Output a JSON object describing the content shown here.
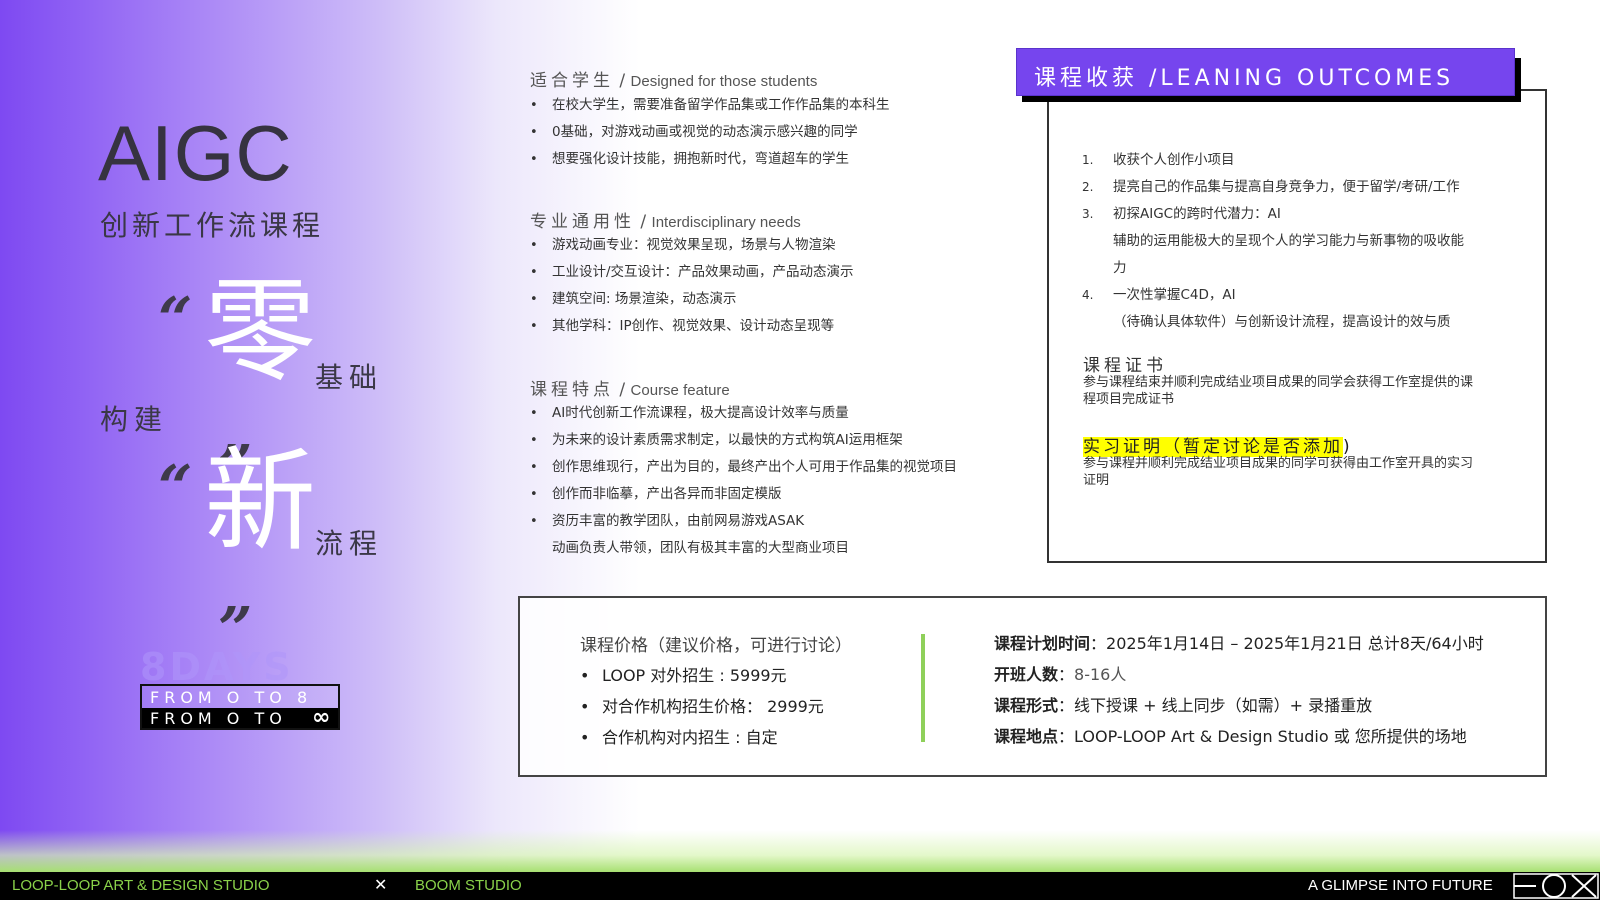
{
  "hero": {
    "title": "AIGC",
    "subtitle": "创新工作流课程",
    "quote_open": "“",
    "quote_close": "”",
    "char_zero": "零",
    "word_basic": "基础",
    "word_build": "构建",
    "char_new": "新",
    "word_flow": "流程",
    "days": "8DAYS",
    "from_line1": "FROM O TO 8",
    "from_line2": "FROM O TO",
    "infinity": "∞"
  },
  "students": {
    "title_zh": "适合学生",
    "sep": " / ",
    "title_en": "Designed for those students",
    "items": [
      "在校大学生，需要准备留学作品集或工作作品集的本科生",
      "0基础，对游戏动画或视觉的动态演示感兴趣的同学",
      "想要强化设计技能，拥抱新时代，弯道超车的学生"
    ]
  },
  "interdisciplinary": {
    "title_zh": "专业通用性",
    "sep": " / ",
    "title_en": "Interdisciplinary needs",
    "items": [
      "游戏动画专业：视觉效果呈现，场景与人物渲染",
      "工业设计/交互设计：产品效果动画，产品动态演示",
      "建筑空间: 场景渲染，动态演示",
      "其他学科：IP创作、视觉效果、设计动态呈现等"
    ]
  },
  "features": {
    "title_zh": "课程特点",
    "sep": " / ",
    "title_en": "Course feature",
    "items": [
      "AI时代创新工作流课程，极大提高设计效率与质量",
      "为未来的设计素质需求制定，以最快的方式构筑AI运用框架",
      "创作思维现行，产出为目的，最终产出个人可用于作品集的视觉项目",
      "创作而非临摹，产出各异而非固定模版",
      "资历丰富的教学团队，由前网易游戏ASAK",
      "动画负责人带领，团队有极其丰富的大型商业项目"
    ]
  },
  "outcomes": {
    "title": "课程收获 /LEANING OUTCOMES",
    "items": [
      {
        "num": "1.",
        "text": "收获个人创作小项目"
      },
      {
        "num": "2.",
        "text": "提亮自己的作品集与提高自身竞争力，便于留学/考研/工作"
      },
      {
        "num": "3.",
        "text": "初探AIGC的跨时代潜力：AI"
      },
      {
        "num": "",
        "text": "辅助的运用能极大的呈现个人的学习能力与新事物的吸收能"
      },
      {
        "num": "",
        "text": "力"
      },
      {
        "num": "4.",
        "text": "一次性掌握C4D，AI"
      },
      {
        "num": "",
        "text": "（待确认具体软件）与创新设计流程，提高设计的效与质"
      }
    ],
    "cert_title": "课程证书",
    "cert_text": "参与课程结束并顺利完成结业项目成果的同学会获得工作室提供的课程项目完成证书",
    "intern_title_highlight": "实习证明（暂定讨论是否添加",
    "intern_title_tail": ")",
    "intern_text": "参与课程并顺利完成结业项目成果的同学可获得由工作室开具的实习证明"
  },
  "pricing": {
    "title": "课程价格（建议价格，可进行讨论）",
    "items": [
      "LOOP 对外招生 : 5999元",
      "对合作机构招生价格： 2999元",
      "合作机构对内招生 : 自定"
    ]
  },
  "schedule": {
    "time_label": "课程计划时间",
    "time_value": "2025年1月14日 – 2025年1月21日 总计8天/64小时",
    "size_label": "开班人数",
    "size_value": "8-16人",
    "format_label": "课程形式",
    "format_value": "线下授课 + 线上同步（如需）+ 录播重放",
    "location_label": "课程地点",
    "location_value": "LOOP-LOOP Art & Design Studio 或 您所提供的场地",
    "colon": "："
  },
  "footer": {
    "left": "LOOP-LOOP ART & DESIGN STUDIO",
    "x": "✕",
    "middle": "BOOM STUDIO",
    "right": "A GLIMPSE INTO FUTURE"
  },
  "colors": {
    "accent_purple": "#7645ee",
    "footer_green": "#8ad24a",
    "divider_green": "#8fd05a",
    "highlight_yellow": "#ffff00"
  }
}
